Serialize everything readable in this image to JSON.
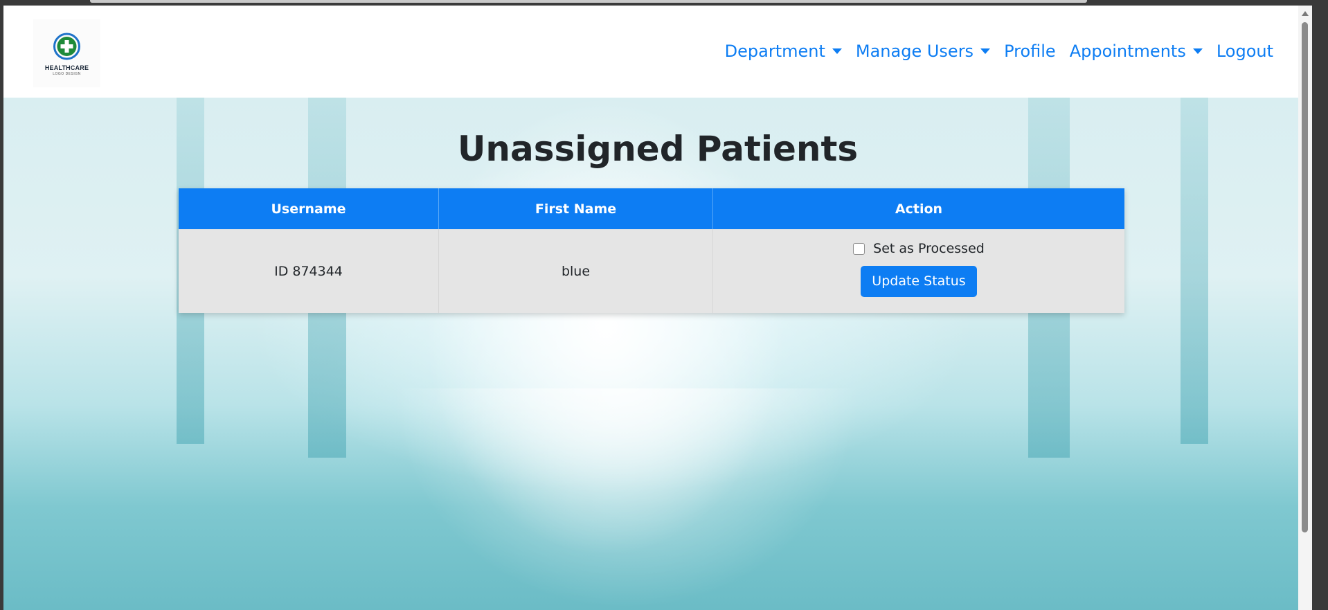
{
  "logo": {
    "name": "HEALTHCARE",
    "tagline": "LOGO DESIGN"
  },
  "nav": {
    "department": "Department",
    "manage_users": "Manage Users",
    "profile": "Profile",
    "appointments": "Appointments",
    "logout": "Logout"
  },
  "page": {
    "title": "Unassigned Patients"
  },
  "table": {
    "headers": [
      "Username",
      "First Name",
      "Action"
    ],
    "rows": [
      {
        "username": "ID 874344",
        "first_name": "blue",
        "checkbox_label": "Set as Processed",
        "checked": false,
        "button_label": "Update Status"
      }
    ]
  },
  "colors": {
    "accent": "#0d7df3",
    "row_bg": "#e5e5e5",
    "title": "#212529"
  },
  "icons": [
    "medical-cross-icon",
    "caret-down-icon"
  ]
}
